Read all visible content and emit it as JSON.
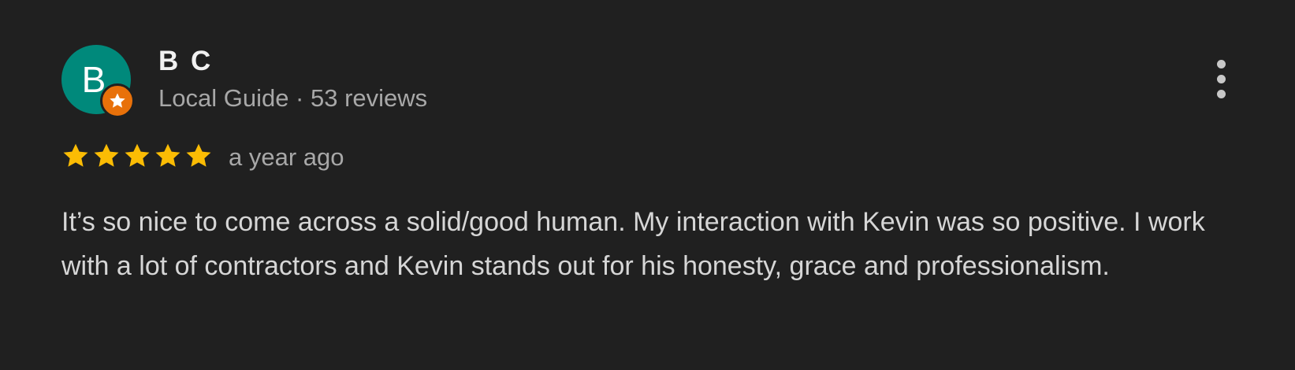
{
  "reviewer": {
    "avatar_letter": "B",
    "avatar_color": "#00897b",
    "badge_color": "#e8710a",
    "badge_icon": "star-icon",
    "name": "B C",
    "meta": "Local Guide · 53 reviews"
  },
  "review": {
    "rating": 5,
    "rating_max": 5,
    "star_color": "#fbbc04",
    "time": "a year ago",
    "text": "It’s so nice to come across a solid/good human. My interaction with Kevin was so positive. I work with a lot of contractors and Kevin stands out for his honesty, grace and professionalism."
  },
  "actions": {
    "more_icon": "more-vert-icon"
  },
  "colors": {
    "background": "#202020"
  }
}
